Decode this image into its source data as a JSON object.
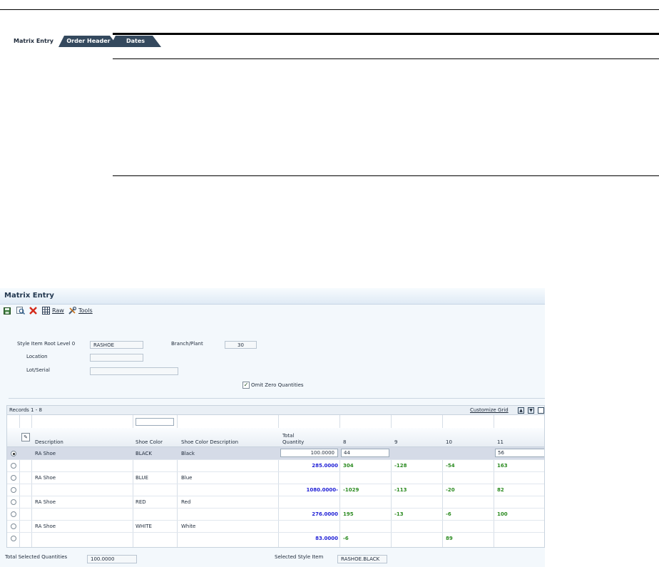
{
  "window": {
    "title": "Matrix Entry"
  },
  "toolbar": {
    "raw_label": "Raw",
    "tools_label": "Tools"
  },
  "tabs": [
    {
      "label": "Matrix Entry",
      "active": true
    },
    {
      "label": "Order Header",
      "active": false
    },
    {
      "label": "Dates",
      "active": false
    }
  ],
  "form": {
    "style_item_label": "Style Item Root Level 0",
    "style_item_value": "RASHOE",
    "branch_plant_label": "Branch/Plant",
    "branch_plant_value": "30",
    "location_label": "Location",
    "location_value": "",
    "lot_serial_label": "Lot/Serial",
    "lot_serial_value": "",
    "omit_zero_label": "Omit Zero Quantities",
    "omit_zero_checked": true
  },
  "grid": {
    "records_label": "Records 1 - 8",
    "customize_label": "Customize Grid",
    "columns": [
      "Description",
      "Shoe Color",
      "Shoe Color Description",
      "Total Quantity",
      "8",
      "9",
      "10",
      "11"
    ],
    "total_quantity_line1": "Total",
    "total_quantity_line2": "Quantity",
    "rows": [
      {
        "selected": true,
        "desc": "RA Shoe",
        "color": "BLACK",
        "color_desc": "Black",
        "total": "100.0000",
        "c8": "44",
        "c9": "",
        "c10": "",
        "c11": "56"
      },
      {
        "selected": false,
        "desc": "",
        "color": "",
        "color_desc": "",
        "total": "285.0000",
        "c8": "304",
        "c9": "-128",
        "c10": "-54",
        "c11": "163"
      },
      {
        "selected": false,
        "desc": "RA Shoe",
        "color": "BLUE",
        "color_desc": "Blue",
        "total": "",
        "c8": "",
        "c9": "",
        "c10": "",
        "c11": ""
      },
      {
        "selected": false,
        "desc": "",
        "color": "",
        "color_desc": "",
        "total": "1080.0000-",
        "c8": "-1029",
        "c9": "-113",
        "c10": "-20",
        "c11": "82"
      },
      {
        "selected": false,
        "desc": "RA Shoe",
        "color": "RED",
        "color_desc": "Red",
        "total": "",
        "c8": "",
        "c9": "",
        "c10": "",
        "c11": ""
      },
      {
        "selected": false,
        "desc": "",
        "color": "",
        "color_desc": "",
        "total": "276.0000",
        "c8": "195",
        "c9": "-13",
        "c10": "-6",
        "c11": "100"
      },
      {
        "selected": false,
        "desc": "RA Shoe",
        "color": "WHITE",
        "color_desc": "White",
        "total": "",
        "c8": "",
        "c9": "",
        "c10": "",
        "c11": ""
      },
      {
        "selected": false,
        "desc": "",
        "color": "",
        "color_desc": "",
        "total": "83.0000",
        "c8": "-6",
        "c9": "",
        "c10": "89",
        "c11": ""
      }
    ]
  },
  "footer": {
    "total_selected_label": "Total Selected Quantities",
    "total_selected_value": "100.0000",
    "selected_style_label": "Selected Style Item",
    "selected_style_value": "RASHOE.BLACK"
  },
  "colors": {
    "accent_dark": "#34495e",
    "blue_total": "#1f1fd6",
    "green_qty": "#2a8a1f"
  }
}
